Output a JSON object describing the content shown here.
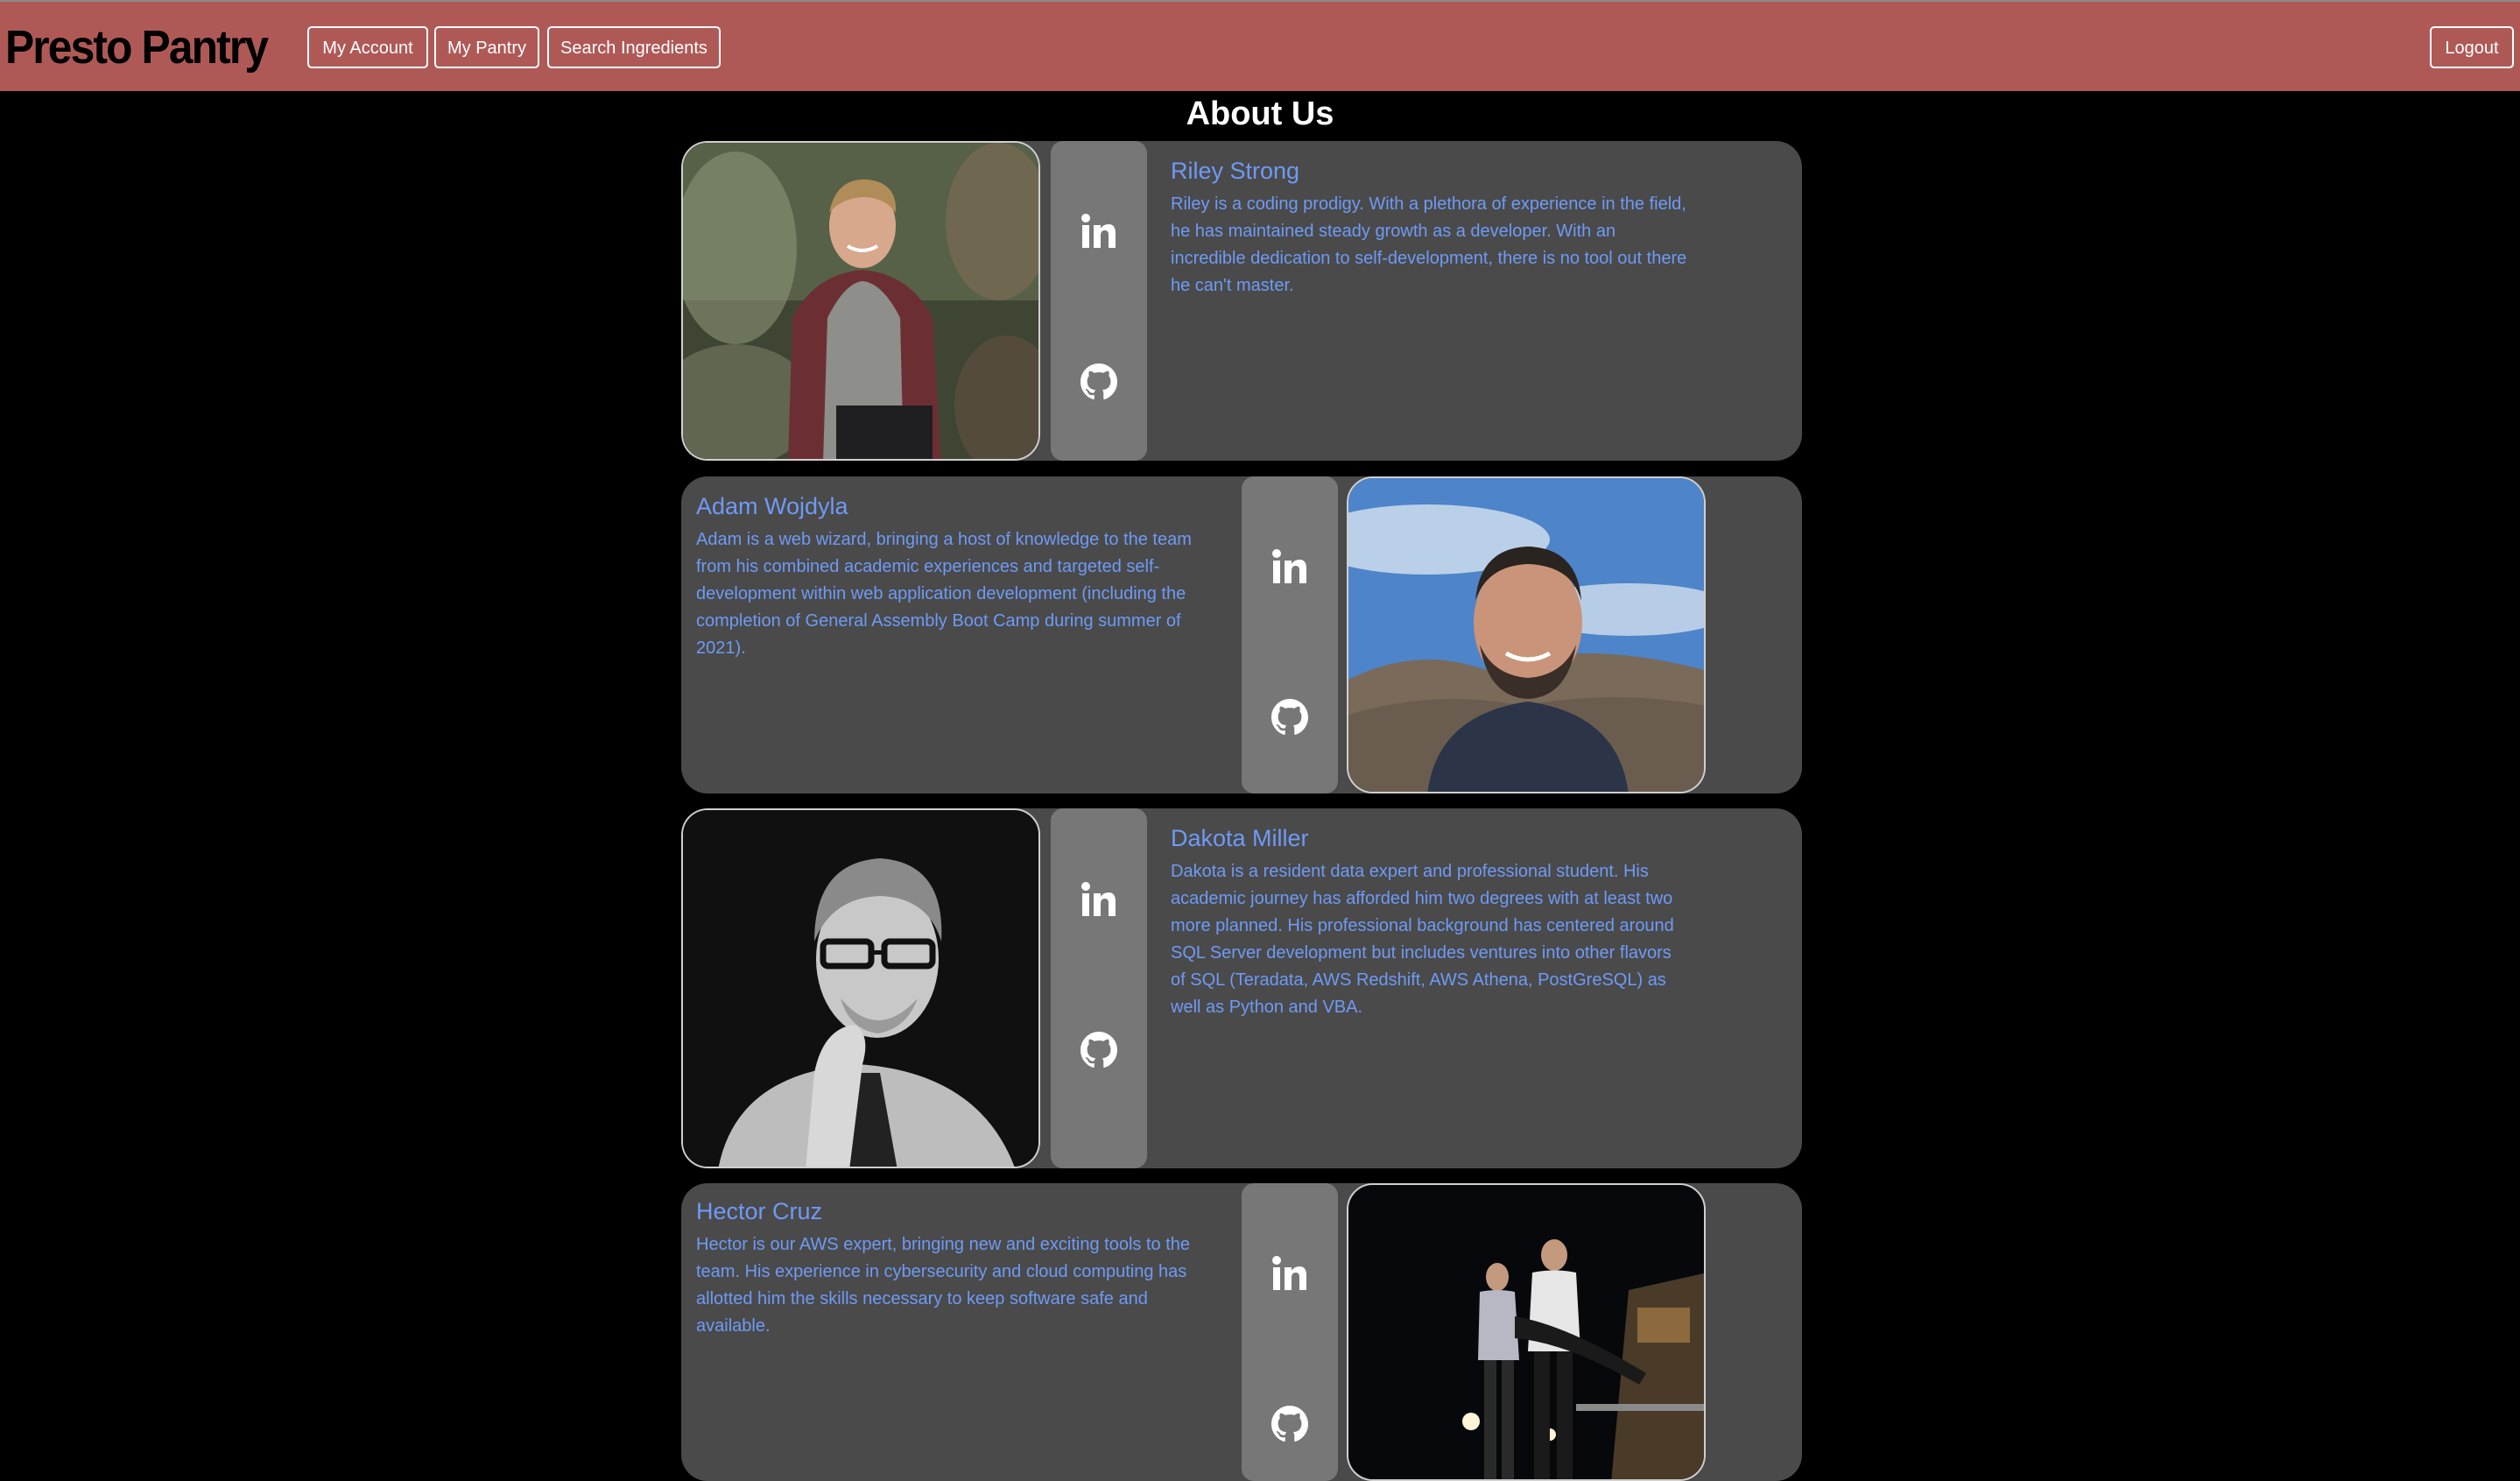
{
  "brand": "Presto Pantry",
  "nav": {
    "my_account": "My Account",
    "my_pantry": "My Pantry",
    "search_ingredients": "Search Ingredients",
    "logout": "Logout"
  },
  "page_title": "About Us",
  "colors": {
    "navbar": "#af5957",
    "card": "#4a4a4a",
    "social_column": "#777777",
    "link_text": "#6f9af5",
    "background": "#000000"
  },
  "icons": {
    "linkedin": "linkedin-icon",
    "github": "github-icon"
  },
  "team": [
    {
      "name": "Riley Strong",
      "bio": "Riley is a coding prodigy. With a plethora of experience in the field, he has maintained steady growth as a developer. With an incredible dedication to self-development, there is no tool out there he can't master."
    },
    {
      "name": "Adam Wojdyla",
      "bio": "Adam is a web wizard, bringing a host of knowledge to the team from his combined academic experiences and targeted self-development within web application development (including the completion of General Assembly Boot Camp during summer of 2021)."
    },
    {
      "name": "Dakota Miller",
      "bio": "Dakota is a resident data expert and professional student. His academic journey has afforded him two degrees with at least two more planned. His professional background has centered around SQL Server development but includes ventures into other flavors of SQL (Teradata, AWS Redshift, AWS Athena, PostGreSQL) as well as Python and VBA."
    },
    {
      "name": "Hector Cruz",
      "bio": "Hector is our AWS expert, bringing new and exciting tools to the team. His experience in cybersecurity and cloud computing has allotted him the skills necessary to keep software safe and available."
    }
  ]
}
